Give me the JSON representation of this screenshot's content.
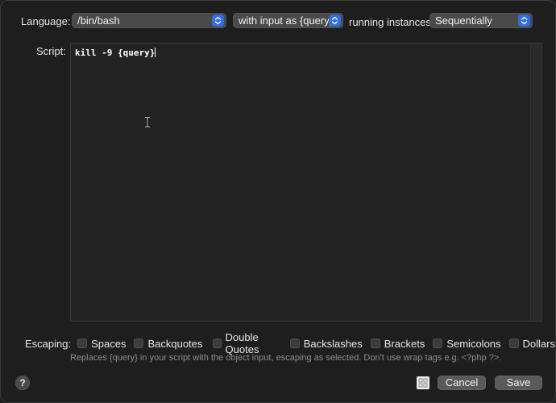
{
  "header": {
    "language_label": "Language:",
    "language_value": "/bin/bash",
    "input_mode_value": "with input as {query}",
    "running_label": "running instances",
    "running_value": "Sequentially"
  },
  "script": {
    "label": "Script:",
    "code": "kill -9 {query}"
  },
  "escaping": {
    "label": "Escaping:",
    "options": [
      {
        "label": "Spaces",
        "checked": false
      },
      {
        "label": "Backquotes",
        "checked": false
      },
      {
        "label": "Double Quotes",
        "checked": false
      },
      {
        "label": "Backslashes",
        "checked": false
      },
      {
        "label": "Brackets",
        "checked": false
      },
      {
        "label": "Semicolons",
        "checked": false
      },
      {
        "label": "Dollars",
        "checked": false
      }
    ],
    "hint": "Replaces {query} in your script with the object input, escaping as selected. Don't use wrap tags e.g. <?php ?>."
  },
  "footer": {
    "help_label": "?",
    "cancel_label": "Cancel",
    "save_label": "Save"
  },
  "colors": {
    "accent": "#2f6fe0",
    "background": "#1e1e1e"
  },
  "icons": {
    "popup": "chevron-up-down-icon",
    "cursor": "ibeam-cursor-icon",
    "grid": "grid-icon"
  }
}
